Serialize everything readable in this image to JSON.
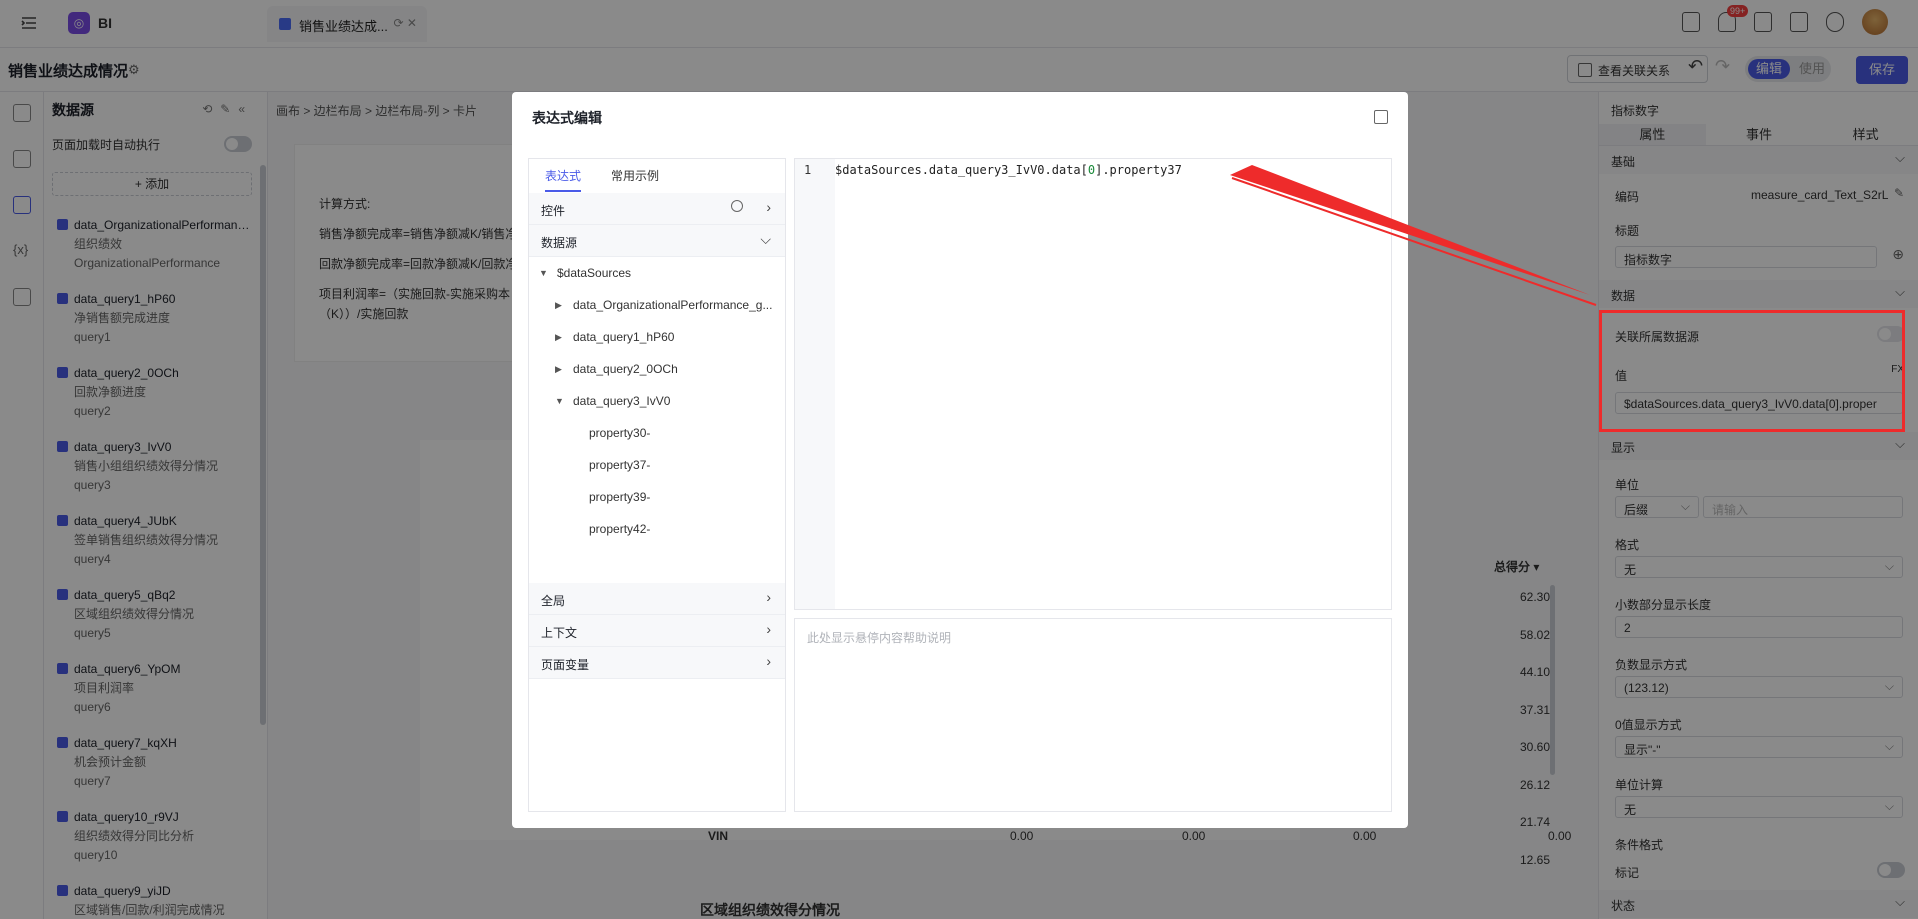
{
  "app": {
    "name": "BI",
    "tab_title": "销售业绩达成...",
    "notif_count": "99+"
  },
  "page": {
    "title": "销售业绩达成情况",
    "relation_btn": "查看关联关系",
    "mode_edit": "编辑",
    "mode_use": "使用",
    "save": "保存"
  },
  "datasource_panel": {
    "title": "数据源",
    "auto_exec_label": "页面加载时自动执行",
    "add_label": "+ 添加",
    "items": [
      {
        "name": "data_OrganizationalPerformance_g...",
        "desc": "组织绩效",
        "source": "OrganizationalPerformance"
      },
      {
        "name": "data_query1_hP60",
        "desc": "净销售额完成进度",
        "source": "query1"
      },
      {
        "name": "data_query2_0OCh",
        "desc": "回款净额进度",
        "source": "query2"
      },
      {
        "name": "data_query3_IvV0",
        "desc": "销售小组组织绩效得分情况",
        "source": "query3"
      },
      {
        "name": "data_query4_JUbK",
        "desc": "签单销售组织绩效得分情况",
        "source": "query4"
      },
      {
        "name": "data_query5_qBq2",
        "desc": "区域组织绩效得分情况",
        "source": "query5"
      },
      {
        "name": "data_query6_YpOM",
        "desc": "项目利润率",
        "source": "query6"
      },
      {
        "name": "data_query7_kqXH",
        "desc": "机会预计金额",
        "source": "query7"
      },
      {
        "name": "data_query10_r9VJ",
        "desc": "组织绩效得分同比分析",
        "source": "query10"
      },
      {
        "name": "data_query9_yiJD",
        "desc": "区域销售/回款/利润完成情况",
        "source": ""
      }
    ]
  },
  "canvas": {
    "breadcrumb": "画布  >  边栏布局  >  边栏布局-列  >  卡片",
    "calc_title": "计算方式:",
    "calc_lines": [
      "销售净额完成率=销售净额减K/销售净额目标",
      "回款净额完成率=回款净额减K/回款净额目标",
      "项目利润率=（实施回款-实施采购本",
      "（K））/实施回款"
    ],
    "table_header": "总得分 ▾",
    "table_values": [
      "62.30",
      "58.02",
      "44.10",
      "37.31",
      "30.60",
      "26.12",
      "21.74",
      "12.65"
    ],
    "vin_row": {
      "label": "VIN",
      "c1": "0.00",
      "c2": "0.00",
      "c3": "0.00",
      "c4": "0.00"
    },
    "section_title": "区域组织绩效得分情况"
  },
  "right_panel": {
    "title": "指标数字",
    "tabs": [
      "属性",
      "事件",
      "样式"
    ],
    "sec_basic": "基础",
    "code_label": "编码",
    "code_value": "measure_card_Text_S2rL",
    "title_label": "标题",
    "title_value": "指标数字",
    "sec_data": "数据",
    "link_ds_label": "关联所属数据源",
    "value_label": "值",
    "fx": "FX",
    "value_text": "$dataSources.data_query3_IvV0.data[0].proper",
    "sec_display": "显示",
    "unit_label": "单位",
    "unit_pos": "后缀",
    "unit_placeholder": "请输入",
    "format_label": "格式",
    "format_value": "无",
    "decimal_label": "小数部分显示长度",
    "decimal_value": "2",
    "neg_label": "负数显示方式",
    "neg_value": "(123.12)",
    "zero_label": "0值显示方式",
    "zero_value": "显示\"-\"",
    "unit_calc_label": "单位计算",
    "unit_calc_value": "无",
    "cond_label": "条件格式",
    "mark_label": "标记",
    "sec_state": "状态"
  },
  "modal": {
    "title": "表达式编辑",
    "tab_expr": "表达式",
    "tab_examples": "常用示例",
    "row_controls": "控件",
    "row_datasource": "数据源",
    "tree_root": "$dataSources",
    "tree_items": [
      "data_OrganizationalPerformance_g...",
      "data_query1_hP60",
      "data_query2_0OCh",
      "data_query3_IvV0"
    ],
    "tree_props": [
      "property30-",
      "property37-",
      "property39-",
      "property42-"
    ],
    "row_global": "全局",
    "row_context": "上下文",
    "row_pagevar": "页面变量",
    "line_no": "1",
    "code_prefix": "$dataSources.data_query3_IvV0.data[",
    "code_index": "0",
    "code_suffix": "].property37",
    "help_text": "此处显示悬停内容帮助说明"
  },
  "colors": {
    "accent": "#4a5be8",
    "highlight": "#ee2b2b"
  }
}
